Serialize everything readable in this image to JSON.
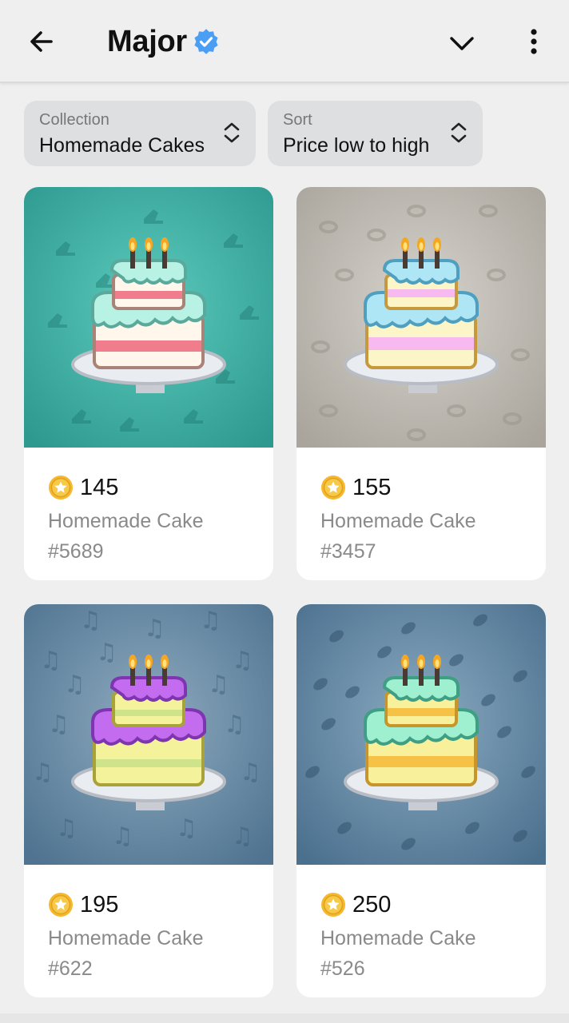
{
  "header": {
    "title": "Major",
    "verified_color": "#4a9ff5"
  },
  "filters": {
    "collection": {
      "label": "Collection",
      "value": "Homemade Cakes"
    },
    "sort": {
      "label": "Sort",
      "value": "Price low to high"
    }
  },
  "items": [
    {
      "price": "145",
      "name": "Homemade Cake",
      "number": "#5689",
      "background": "#3aa89d",
      "pattern": "shoe"
    },
    {
      "price": "155",
      "name": "Homemade Cake",
      "number": "#3457",
      "background": "#b6b2aa",
      "pattern": "mask"
    },
    {
      "price": "195",
      "name": "Homemade Cake",
      "number": "#622",
      "background": "#5d7f98",
      "pattern": "music-note"
    },
    {
      "price": "250",
      "name": "Homemade Cake",
      "number": "#526",
      "background": "#5a7e9a",
      "pattern": "leaf"
    }
  ],
  "icons": {
    "back": "arrow-left-icon",
    "collapse": "chevron-down-icon",
    "more": "more-vertical-icon",
    "coin": "star-coin-icon",
    "select": "updown-chevron-icon"
  }
}
